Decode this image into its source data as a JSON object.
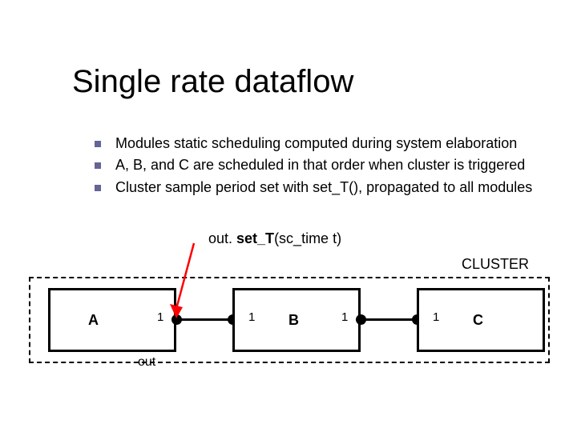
{
  "title": "Single rate dataflow",
  "bullets": [
    "Modules static scheduling computed during system elaboration",
    "A, B, and C are scheduled in that order when cluster is triggered",
    "Cluster sample period set with set_T(), propagated to all modules"
  ],
  "code_line": "out. set_T(sc_time t)",
  "cluster_label": "CLUSTER",
  "modules": {
    "a": {
      "label": "A",
      "out_rate": "1"
    },
    "b": {
      "label": "B",
      "in_rate": "1",
      "out_rate": "1"
    },
    "c": {
      "label": "C",
      "in_rate": "1"
    }
  },
  "port_out_label": "out",
  "chart_data": {
    "type": "diagram",
    "title": "Single rate dataflow",
    "nodes": [
      {
        "id": "A",
        "type": "module",
        "outputs": [
          {
            "name": "out",
            "rate": 1
          }
        ]
      },
      {
        "id": "B",
        "type": "module",
        "inputs": [
          {
            "rate": 1
          }
        ],
        "outputs": [
          {
            "rate": 1
          }
        ]
      },
      {
        "id": "C",
        "type": "module",
        "inputs": [
          {
            "rate": 1
          }
        ]
      }
    ],
    "edges": [
      {
        "from": "A",
        "to": "B"
      },
      {
        "from": "B",
        "to": "C"
      }
    ],
    "cluster": [
      "A",
      "B",
      "C"
    ],
    "annotations": [
      {
        "text": "out. set_T(sc_time t)",
        "points_to": "A.out"
      }
    ]
  }
}
